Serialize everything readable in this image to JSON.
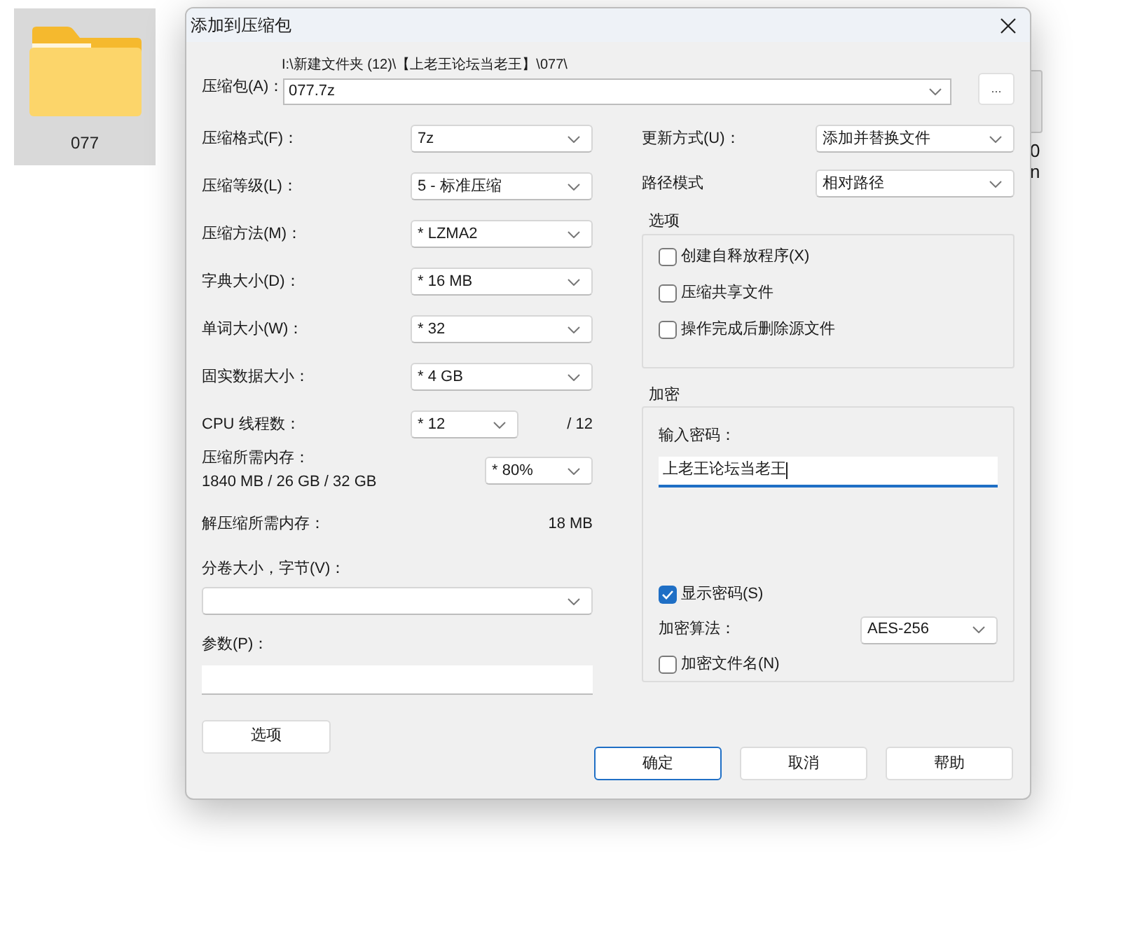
{
  "desktop_item": {
    "label": "077"
  },
  "background_fragments": [
    "0",
    "n"
  ],
  "window": {
    "title": "添加到压缩包"
  },
  "archive": {
    "label": "压缩包(A)：",
    "path": "I:\\新建文件夹 (12)\\【上老王论坛当老王】\\077\\",
    "value": "077.7z",
    "browse_button": "..."
  },
  "left_fields": [
    {
      "label": "压缩格式(F)：",
      "value": "7z"
    },
    {
      "label": "压缩等级(L)：",
      "value": "5 - 标准压缩"
    },
    {
      "label": "压缩方法(M)：",
      "value": "* LZMA2"
    },
    {
      "label": "字典大小(D)：",
      "value": "* 16 MB"
    },
    {
      "label": "单词大小(W)：",
      "value": "* 32"
    },
    {
      "label": "固实数据大小：",
      "value": "* 4 GB"
    },
    {
      "label": "CPU 线程数：",
      "value": "* 12",
      "suffix": "/ 12"
    }
  ],
  "memory": {
    "label": "压缩所需内存：",
    "detail": "1840 MB / 26 GB / 32 GB",
    "value": "* 80%"
  },
  "decompress_memory": {
    "label": "解压缩所需内存：",
    "value": "18 MB"
  },
  "volume": {
    "label": "分卷大小，字节(V)："
  },
  "parameters": {
    "label": "参数(P)："
  },
  "options_button": "选项",
  "right_fields": [
    {
      "label": "更新方式(U)：",
      "value": "添加并替换文件"
    },
    {
      "label": "路径模式",
      "value": "相对路径"
    }
  ],
  "options_group": {
    "title": "选项",
    "checkboxes": [
      {
        "label": "创建自释放程序(X)",
        "checked": false
      },
      {
        "label": "压缩共享文件",
        "checked": false
      },
      {
        "label": "操作完成后删除源文件",
        "checked": false
      }
    ]
  },
  "encryption": {
    "title": "加密",
    "password_label": "输入密码：",
    "password": "上老王论坛当老王",
    "show_password": {
      "label": "显示密码(S)",
      "checked": true
    },
    "method_label": "加密算法：",
    "method": "AES-256",
    "encrypt_names": {
      "label": "加密文件名(N)",
      "checked": false
    }
  },
  "buttons": [
    {
      "label": "确定",
      "default": true
    },
    {
      "label": "取消",
      "default": false
    },
    {
      "label": "帮助",
      "default": false
    }
  ]
}
